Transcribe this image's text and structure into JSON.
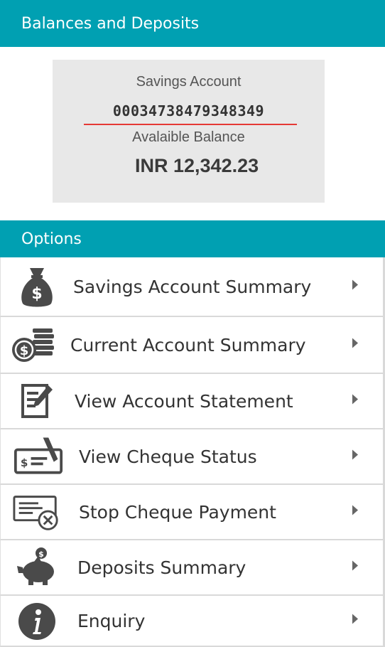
{
  "balances": {
    "header": "Balances and Deposits",
    "account_type": "Savings Account",
    "account_number": "00034738479348349",
    "balance_label": "Avalaible Balance",
    "balance_amount": "INR 12,342.23"
  },
  "options": {
    "header": "Options",
    "items": [
      {
        "label": "Savings Account Summary",
        "icon": "money-bag-icon"
      },
      {
        "label": "Current Account Summary",
        "icon": "coins-stack-icon"
      },
      {
        "label": "View Account Statement",
        "icon": "statement-edit-icon"
      },
      {
        "label": "View Cheque Status",
        "icon": "cheque-pen-icon"
      },
      {
        "label": "Stop Cheque Payment",
        "icon": "cheque-cancel-icon"
      },
      {
        "label": "Deposits Summary",
        "icon": "piggy-bank-icon"
      },
      {
        "label": "Enquiry",
        "icon": "info-icon"
      }
    ]
  },
  "colors": {
    "header_bg": "#00a0b2",
    "card_bg": "#e8e8e8",
    "underline": "#e53935",
    "icon": "#4a4a4a"
  }
}
